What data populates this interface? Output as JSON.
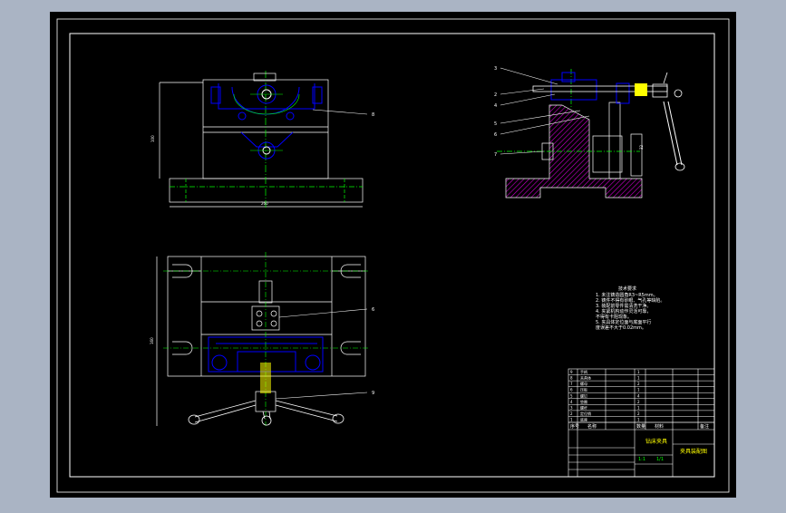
{
  "drawing": {
    "background": "#000000",
    "outer_frame_color": "#aab4c4",
    "line_colors": {
      "outline": "#ffffff",
      "part": "#0000ff",
      "center": "#00ff00",
      "hatch": "#cc00cc",
      "leader": "#ffffff",
      "handle": "#ffff00"
    }
  },
  "balloons": {
    "front_view": [
      "8"
    ],
    "top_view": [
      "6",
      "9"
    ],
    "side_view": [
      "3",
      "2",
      "4",
      "5",
      "6",
      "7"
    ]
  },
  "dimensions": {
    "front_height": "100",
    "front_width": "260",
    "top_height": "160",
    "side_small": "32"
  },
  "notes": {
    "title": "技术要求",
    "lines": [
      "1. 未注铸造圆角R3~R5mm。",
      "2. 铸件不得有砂眼、气孔等缺陷。",
      "3. 装配前零件需清洗干净。",
      "4. 夹紧机构动作灵活可靠，",
      "   不得有卡阻现象。",
      "5. 夹具体定位面与底面平行",
      "   度误差不大于0.02mm。"
    ]
  },
  "title_block": {
    "parts_rows": [
      {
        "no": "9",
        "name": "手柄",
        "qty": "1"
      },
      {
        "no": "8",
        "name": "夹具体",
        "qty": "1"
      },
      {
        "no": "7",
        "name": "螺母",
        "qty": "2"
      },
      {
        "no": "6",
        "name": "压板",
        "qty": "1"
      },
      {
        "no": "5",
        "name": "螺钉",
        "qty": "4"
      },
      {
        "no": "4",
        "name": "垫圈",
        "qty": "2"
      },
      {
        "no": "3",
        "name": "螺杆",
        "qty": "1"
      },
      {
        "no": "2",
        "name": "定位销",
        "qty": "2"
      },
      {
        "no": "1",
        "name": "底座",
        "qty": "1"
      }
    ],
    "header": {
      "no": "序号",
      "name": "名称",
      "qty": "数量",
      "material": "材料",
      "note": "备注"
    },
    "drawing_name": "钻床夹具",
    "drawing_title": "夹具装配图",
    "scale": "1:1",
    "sheet": "1/1"
  }
}
